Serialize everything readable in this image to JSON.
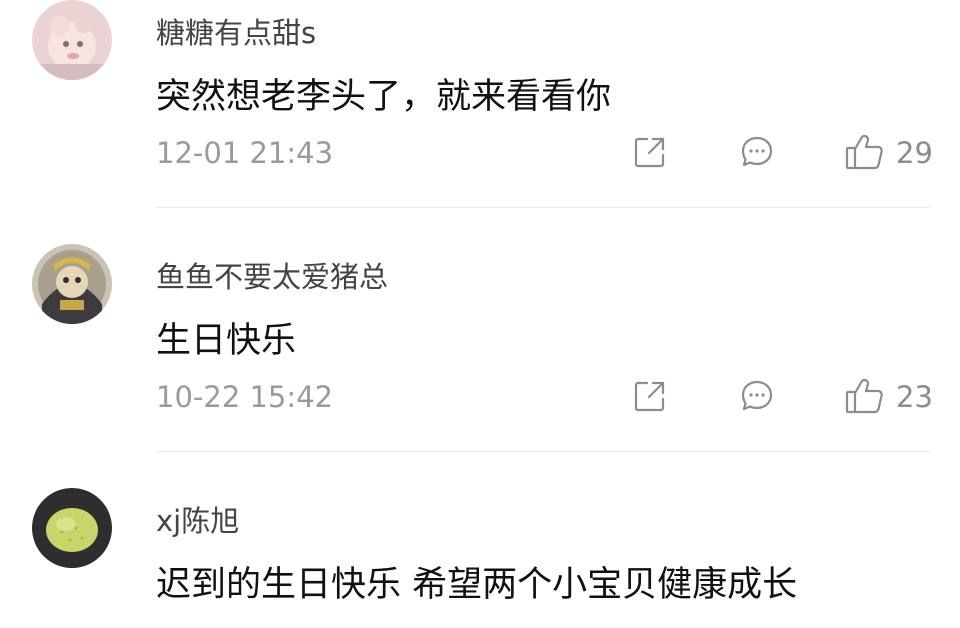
{
  "comments": [
    {
      "username": "糖糖有点甜s",
      "text": "突然想老李头了，就来看看你",
      "time": "12-01 21:43",
      "likes": "29",
      "avatar_icon": "plush-toy-avatar"
    },
    {
      "username": "鱼鱼不要太爱猪总",
      "text": "生日快乐",
      "time": "10-22 15:42",
      "likes": "23",
      "avatar_icon": "cartoon-character-avatar"
    },
    {
      "username": "xj陈旭",
      "text": "迟到的生日快乐 希望两个小宝贝健康成长",
      "time": "",
      "likes": "",
      "avatar_icon": "green-egg-avatar"
    }
  ],
  "icons": {
    "share": "share-icon",
    "reply": "comment-bubble-icon",
    "like": "thumbs-up-icon"
  },
  "colors": {
    "username": "#444444",
    "meta": "#9a9a9a",
    "divider": "#e8e8e8"
  }
}
